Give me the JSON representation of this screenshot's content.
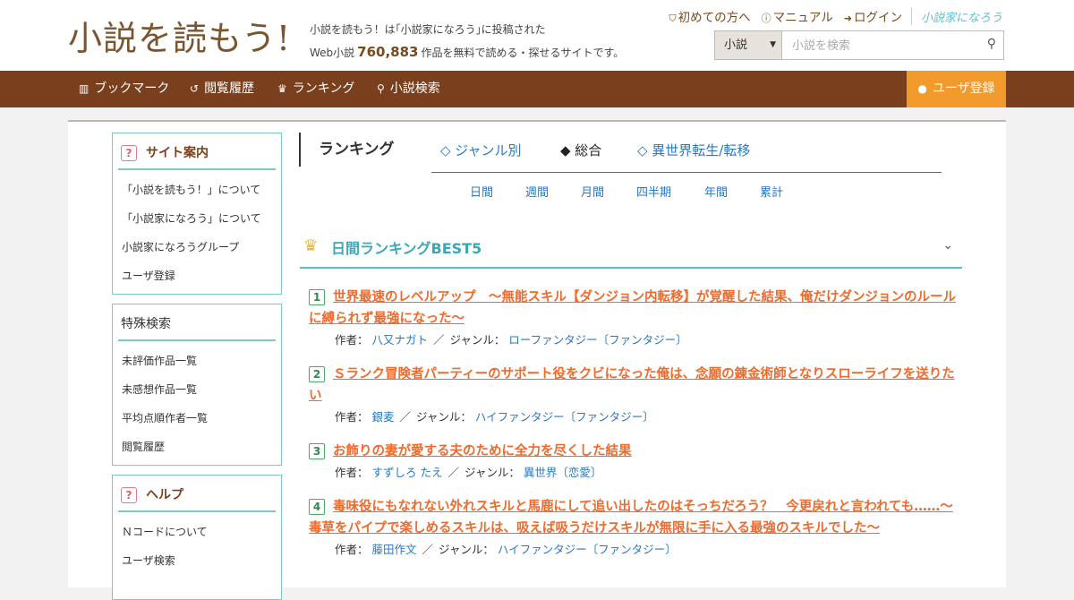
{
  "header": {
    "logo": "小説を読もう!",
    "intro_line1": "小説を読もう！は｢小説家になろう｣に投稿された",
    "intro_prefix": "Web小説",
    "work_count": "760,883",
    "intro_suffix": "作品を無料で読める・探せるサイトです。",
    "links": [
      {
        "label": "初めての方へ",
        "icon": "shield-icon"
      },
      {
        "label": "マニュアル",
        "icon": "question-circle-icon"
      },
      {
        "label": "ログイン",
        "icon": "login-icon"
      }
    ],
    "brand_small": "小説家になろう",
    "search": {
      "select_value": "小説",
      "placeholder": "小説を検索"
    }
  },
  "nav": {
    "items": [
      {
        "label": "ブックマーク",
        "icon": "bookmark-icon"
      },
      {
        "label": "閲覧履歴",
        "icon": "history-icon"
      },
      {
        "label": "ランキング",
        "icon": "crown-icon"
      },
      {
        "label": "小説検索",
        "icon": "search-icon"
      }
    ],
    "register": "ユーザ登録"
  },
  "sidebar": {
    "site_guide": {
      "title": "サイト案内",
      "items": [
        "「小説を読もう！」について",
        "「小説家になろう」について",
        "小説家になろうグループ",
        "ユーザ登録"
      ]
    },
    "special_search": {
      "title": "特殊検索",
      "items": [
        "未評価作品一覧",
        "未感想作品一覧",
        "平均点順作者一覧",
        "閲覧履歴"
      ]
    },
    "help": {
      "title": "ヘルプ",
      "items": [
        "Ｎコードについて",
        "ユーザ検索"
      ]
    }
  },
  "ranking": {
    "title": "ランキング",
    "tabs": [
      "◇ ジャンル別",
      "◆ 総合",
      "◇ 異世界転生/転移"
    ],
    "periods": [
      "日間",
      "週間",
      "月間",
      "四半期",
      "年間",
      "累計"
    ],
    "section_title": "日間ランキングBEST5",
    "author_label": "作者：",
    "genre_label": "ジャンル：",
    "entries": [
      {
        "rank": "1",
        "title": "世界最速のレベルアップ　～無能スキル【ダンジョン内転移】が覚醒した結果、俺だけダンジョンのルールに縛られず最強になった～",
        "author": "八又ナガト",
        "genre": "ローファンタジー〔ファンタジー〕"
      },
      {
        "rank": "2",
        "title": "Ｓランク冒険者パーティーのサポート役をクビになった俺は、念願の錬金術師となりスローライフを送りたい",
        "author": "銀麦",
        "genre": "ハイファンタジー〔ファンタジー〕"
      },
      {
        "rank": "3",
        "title": "お飾りの妻が愛する夫のために全力を尽くした結果",
        "author": "すずしろ たえ",
        "genre": "異世界〔恋愛〕"
      },
      {
        "rank": "4",
        "title": "毒味役にもなれない外れスキルと馬鹿にして追い出したのはそっちだろう？　今更戻れと言われても……～毒草をパイプで楽しめるスキルは、吸えば吸うだけスキルが無限に手に入る最強のスキルでした～",
        "author": "藤田作文",
        "genre": "ハイファンタジー〔ファンタジー〕"
      }
    ]
  }
}
